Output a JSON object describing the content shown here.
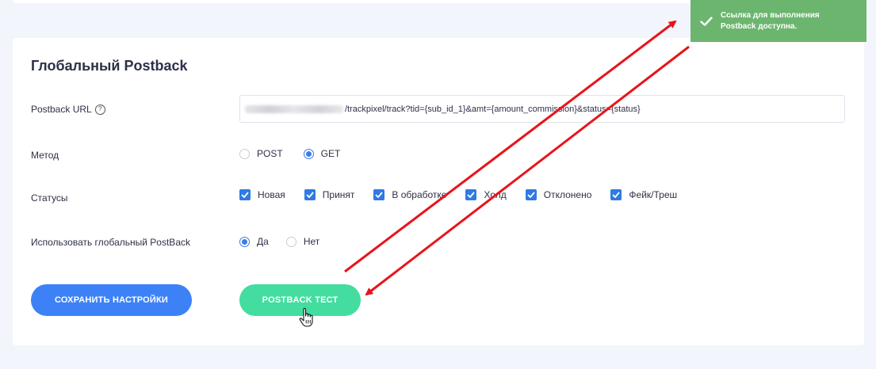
{
  "section": {
    "title": "Глобальный Postback"
  },
  "postback_url": {
    "label": "Postback URL",
    "help_icon": "?",
    "value_visible": "/trackpixel/track?tid={sub_id_1}&amt={amount_commission}&status={status}"
  },
  "method": {
    "label": "Метод",
    "options": [
      {
        "label": "POST",
        "checked": false
      },
      {
        "label": "GET",
        "checked": true
      }
    ]
  },
  "statuses": {
    "label": "Статусы",
    "options": [
      {
        "label": "Новая",
        "checked": true
      },
      {
        "label": "Принят",
        "checked": true
      },
      {
        "label": "В обработке",
        "checked": true
      },
      {
        "label": "Холд",
        "checked": true
      },
      {
        "label": "Отклонено",
        "checked": true
      },
      {
        "label": "Фейк/Треш",
        "checked": true
      }
    ]
  },
  "use_global": {
    "label": "Использовать глобальный PostBack",
    "options": [
      {
        "label": "Да",
        "checked": true
      },
      {
        "label": "Нет",
        "checked": false
      }
    ]
  },
  "buttons": {
    "save": "СОХРАНИТЬ НАСТРОЙКИ",
    "test": "POSTBACK ТЕСТ"
  },
  "toast": {
    "message": "Ссылка для выполнения Postback доступна.",
    "icon": "check-icon"
  },
  "colors": {
    "primary_blue": "#3c82f6",
    "test_green": "#42dd9f",
    "toast_green": "#6cb56f",
    "arrow_red": "#e8141c"
  }
}
